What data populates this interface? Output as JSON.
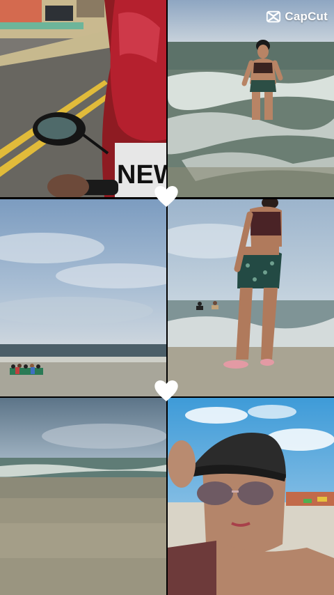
{
  "watermark": {
    "brand": "CapCut",
    "icon": "capcut-logo-icon"
  },
  "photos": [
    {
      "id": "motorcycle-ride",
      "plate_text": "NEW",
      "icon": "motorcycle-photo"
    },
    {
      "id": "woman-in-surf",
      "icon": "beach-photo"
    },
    {
      "id": "cloudy-beach-horizon",
      "icon": "beach-photo"
    },
    {
      "id": "woman-walking-shore",
      "icon": "beach-photo"
    },
    {
      "id": "calm-shoreline",
      "icon": "beach-photo"
    },
    {
      "id": "selfie-with-cap",
      "icon": "selfie-photo"
    }
  ],
  "decorations": {
    "heart_color": "#ffffff",
    "heart_count": 2
  },
  "colors": {
    "sky": "#8fb0cf",
    "sea": "#6f8a86",
    "sand": "#9a9580",
    "accent_red": "#b5202e"
  }
}
